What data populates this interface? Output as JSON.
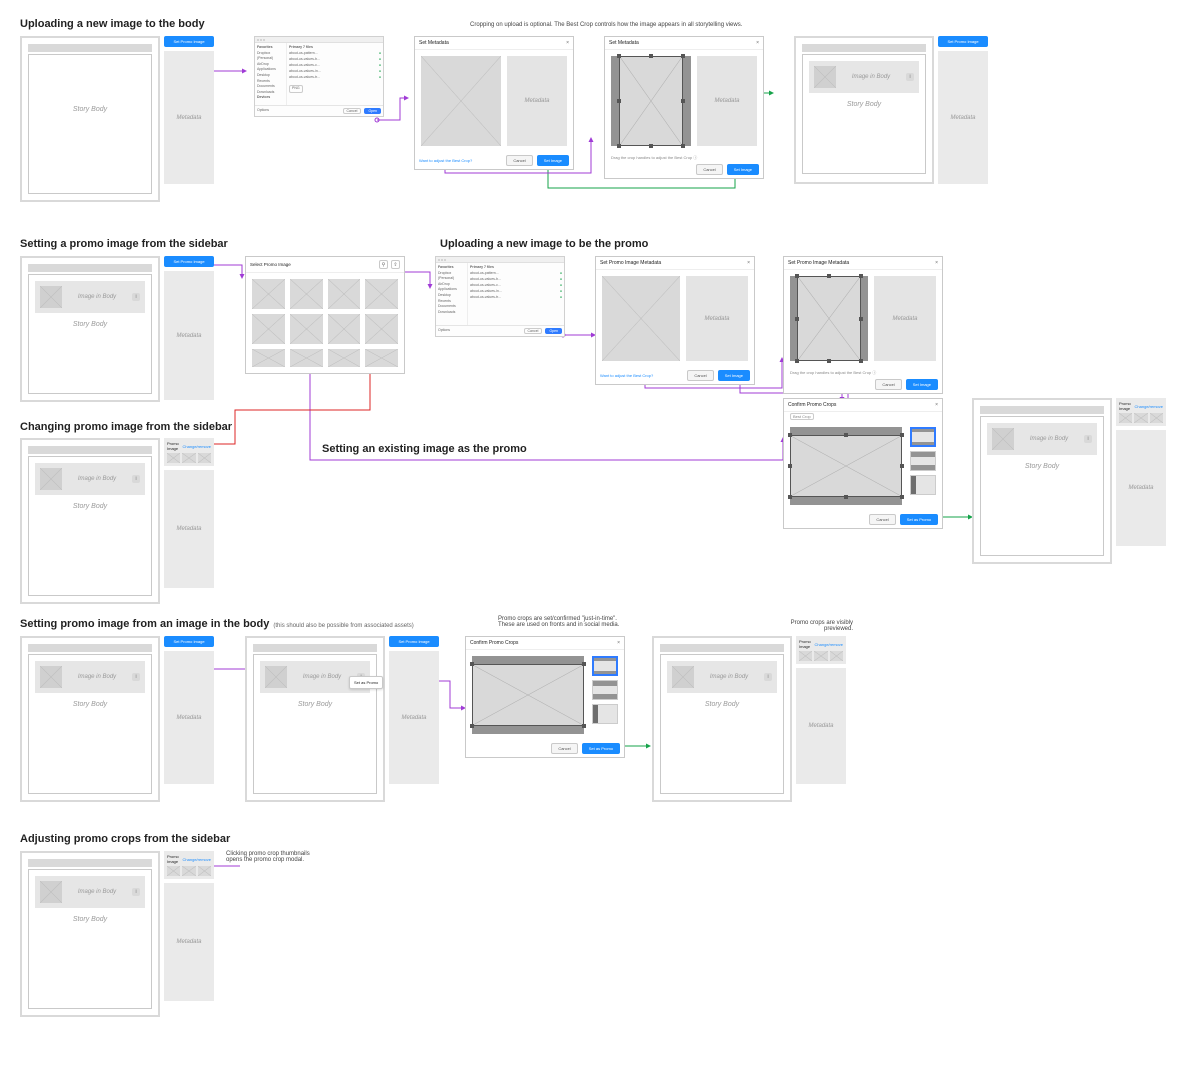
{
  "sections": {
    "s1": "Uploading a new image to the body",
    "s2a": "Setting a promo image from the sidebar",
    "s2b": "Uploading a new image to be the promo",
    "s3a": "Changing promo image from the sidebar",
    "s3b": "Setting an existing image as the promo",
    "s4": "Setting promo image from an image in the body",
    "s4_note": "(this should also be possible from associated assets)",
    "s5": "Adjusting promo crops from the sidebar"
  },
  "captions": {
    "crop_optional": "Cropping on upload is optional. The Best Crop controls how the image appears in all storytelling views.",
    "just_in_time_1": "Promo crops are set/confirmed \"just-in-time\".",
    "just_in_time_2": "These are used on fronts and in social media.",
    "visibly_previewed": "Promo crops are visibly previewed.",
    "click_thumbs_1": "Clicking promo crop thumbnails",
    "click_thumbs_2": "opens the  promo crop modal."
  },
  "editor": {
    "story_body": "Story Body",
    "image_in_body": "Image in Body",
    "metadata": "Metadata",
    "set_promo": "Set Promo Image",
    "promo_image": "Promo Image",
    "change_remove": "Change/remove",
    "info": "i"
  },
  "finder": {
    "favorites": "Favorites",
    "items": [
      "Dropbox (Personal)",
      "AirDrop",
      "Applications",
      "Desktop",
      "Recents",
      "Documents",
      "Downloads"
    ],
    "devices": "Devices",
    "files": [
      "about-us-pattern...",
      "about-us-values-b...",
      "about-us-values-c...",
      "about-us-values-in...",
      "about-us-values-tr..."
    ],
    "header": "Primary 7 files",
    "options": "Options",
    "cancel": "Cancel",
    "open": "Open",
    "picker": "PNG"
  },
  "modals": {
    "set_metadata": "Set Metadata",
    "set_promo_meta": "Set Promo Image Metadata",
    "select_promo": "Select Promo Image",
    "confirm_crops": "Confirm Promo Crops",
    "metadata_ph": "Metadata",
    "cancel": "Cancel",
    "set_image": "Set Image",
    "set_as_promo": "Set as Promo",
    "drag_hint": "Drag the crop handles to adjust the Best Crop ⓘ",
    "adjust_link": "Want to adjust the Best Crop?",
    "close": "×",
    "search": "⚲",
    "upload": "⇧",
    "best_crop_label": "Best Crop"
  }
}
